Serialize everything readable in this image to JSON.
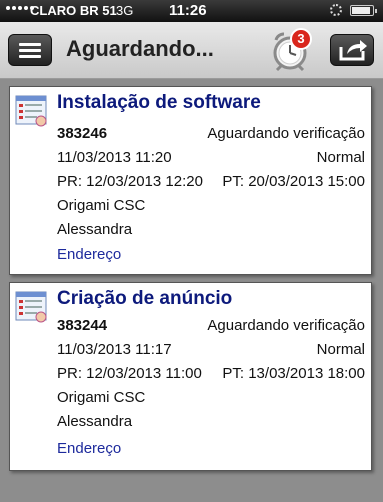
{
  "status_bar": {
    "carrier": "CLARO BR 51",
    "network": "3G",
    "time": "11:26",
    "battery_level": 0.9
  },
  "header": {
    "menu_icon": "hamburger-menu-icon",
    "title": "Aguardando...",
    "alarm_icon": "alarm-clock-icon",
    "badge_count": "3",
    "share_icon": "share-arrow-icon"
  },
  "tickets": [
    {
      "icon": "form-document-icon",
      "title": "Instalação de software",
      "number": "383246",
      "status": "Aguardando verificação",
      "datetime": "11/03/2013 11:20",
      "priority": "Normal",
      "pr": "PR: 12/03/2013 12:20",
      "pt": "PT: 20/03/2013 15:00",
      "organization": "Origami CSC",
      "person": "Alessandra",
      "link": "Endereço"
    },
    {
      "icon": "form-document-icon",
      "title": "Criação de anúncio",
      "number": "383244",
      "status": "Aguardando verificação",
      "datetime": "11/03/2013 11:17",
      "priority": "Normal",
      "pr": "PR: 12/03/2013 11:00",
      "pt": "PT: 13/03/2013 18:00",
      "organization": "Origami CSC",
      "person": "Alessandra",
      "link": "Endereço"
    }
  ],
  "colors": {
    "background": "#8d8d8d",
    "title_blue": "#0d1a7c",
    "link_blue": "#1d2a9c",
    "badge_red": "#d9261c"
  }
}
